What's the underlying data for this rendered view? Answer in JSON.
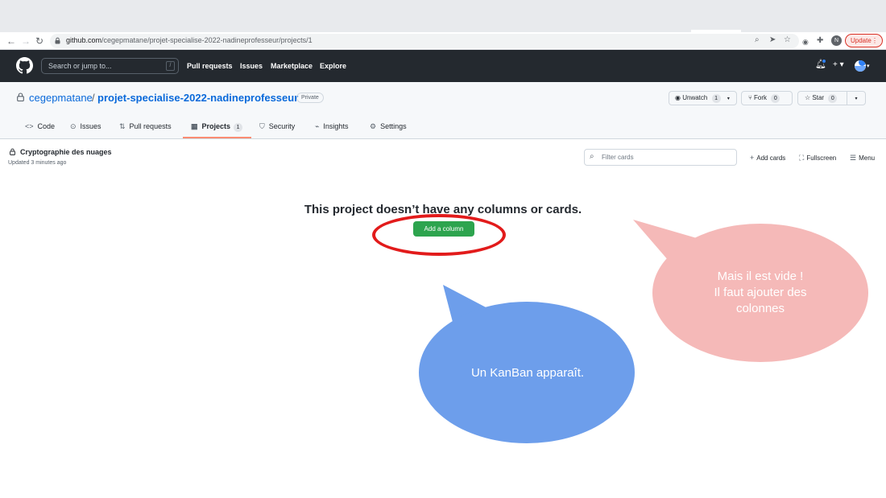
{
  "browser": {
    "url_host": "github.com",
    "url_path": "/cegepmatane/projet-specialise-2022-nadineprofesseur/projects/1",
    "profile_initial": "N",
    "update_label": "Update",
    "update_dots": "⋮"
  },
  "header": {
    "search_placeholder": "Search or jump to...",
    "search_shortcut": "/",
    "nav": [
      "Pull requests",
      "Issues",
      "Marketplace",
      "Explore"
    ],
    "plus_label": "+ ▾",
    "avatar_caret": "▾"
  },
  "repo": {
    "owner": "cegepmatane",
    "separator": "/",
    "name": "projet-specialise-2022-nadineprofesseur",
    "visibility": "Private",
    "unwatch_label": "Unwatch",
    "unwatch_count": "1",
    "fork_label": "Fork",
    "fork_count": "0",
    "star_label": "Star",
    "star_count": "0",
    "tabs": [
      {
        "label": "Code",
        "icon": "<>"
      },
      {
        "label": "Issues",
        "icon": "⊙"
      },
      {
        "label": "Pull requests",
        "icon": "⇅"
      },
      {
        "label": "Projects",
        "icon": "▦",
        "count": "1"
      },
      {
        "label": "Security",
        "icon": "⛉"
      },
      {
        "label": "Insights",
        "icon": "⌁"
      },
      {
        "label": "Settings",
        "icon": "⚙"
      }
    ]
  },
  "project": {
    "title": "Cryptographie des nuages",
    "updated": "Updated 3 minutes ago",
    "filter_placeholder": "Filter cards",
    "add_cards": "Add cards",
    "fullscreen": "Fullscreen",
    "menu": "Menu",
    "empty_message": "This project doesn’t have any columns or cards.",
    "add_column": "Add a column"
  },
  "annotations": {
    "pink_lines": [
      "Mais il est vide !",
      "Il faut ajouter des",
      "colonnes"
    ],
    "blue_text": "Un KanBan apparaît.",
    "pink_color": "#f5b9b8",
    "blue_color": "#6d9eeb",
    "ring_color": "#e21b1b"
  }
}
